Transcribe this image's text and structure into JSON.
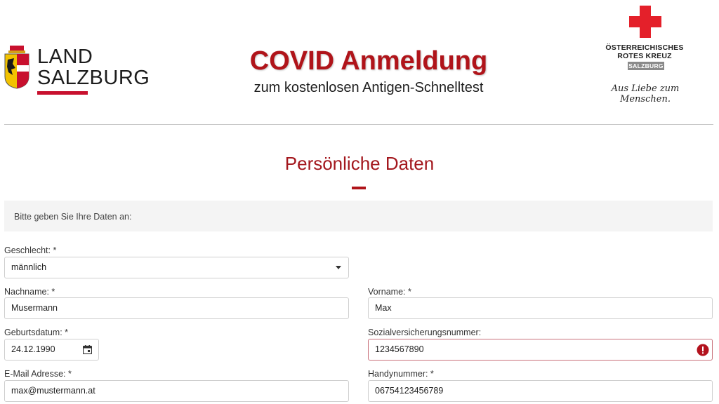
{
  "header": {
    "land_logo": {
      "line1": "LAND",
      "line2": "SALZBURG"
    },
    "title": "COVID Anmeldung",
    "subtitle": "zum kostenlosen Antigen-Schnelltest",
    "rk_logo": {
      "line1": "ÖSTERREICHISCHES",
      "line2": "ROTES KREUZ",
      "badge": "SALZBURG",
      "slogan": "Aus Liebe zum Menschen."
    },
    "colors": {
      "brand_red": "#b0141a",
      "cross_red": "#e4202a"
    }
  },
  "section": {
    "title": "Persönliche Daten",
    "info": "Bitte geben Sie Ihre Daten an:"
  },
  "form": {
    "gender": {
      "label": "Geschlecht: *",
      "value": "männlich"
    },
    "lastname": {
      "label": "Nachname: *",
      "value": "Musermann"
    },
    "firstname": {
      "label": "Vorname: *",
      "value": "Max"
    },
    "birthdate": {
      "label": "Geburtsdatum: *",
      "value": "24.12.1990",
      "icon": "calendar-icon"
    },
    "ssn": {
      "label": "Sozialversicherungsnummer:",
      "value": "1234567890",
      "state": "error",
      "icon": "error-icon"
    },
    "email": {
      "label": "E-Mail Adresse: *",
      "value": "max@mustermann.at"
    },
    "phone": {
      "label": "Handynummer: *",
      "value": "06754123456789"
    }
  }
}
